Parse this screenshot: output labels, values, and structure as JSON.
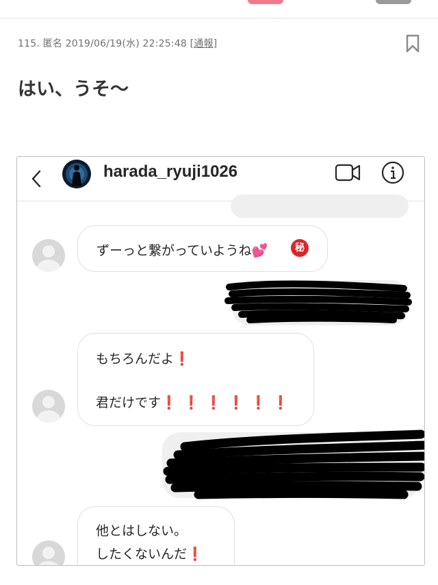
{
  "post": {
    "meta": "115. 匿名 2019/06/19(水) 22:25:48 ",
    "report_label": "[通報]",
    "title": "はい、うそ〜"
  },
  "dm": {
    "username": "harada_ryuji1026",
    "messages": {
      "m1": "ずーっと繋がっていようね💕",
      "m1_emoji": "秘",
      "m2_line1": "もちろんだよ",
      "m2_line2": "君だけです",
      "m2_marks": "❗❗❗❗❗❗",
      "m3_line1": "他とはしない。",
      "m3_line2": "したくないんだ",
      "exclaim": "❗"
    }
  },
  "icons": [
    "bookmark-icon",
    "back-icon",
    "video-call-icon",
    "info-icon",
    "default-avatar-icon"
  ],
  "colors": {
    "accent_pink": "#f07a8c",
    "exclaim_red": "#cc1f1f",
    "sent_bubble": "#efefef"
  }
}
